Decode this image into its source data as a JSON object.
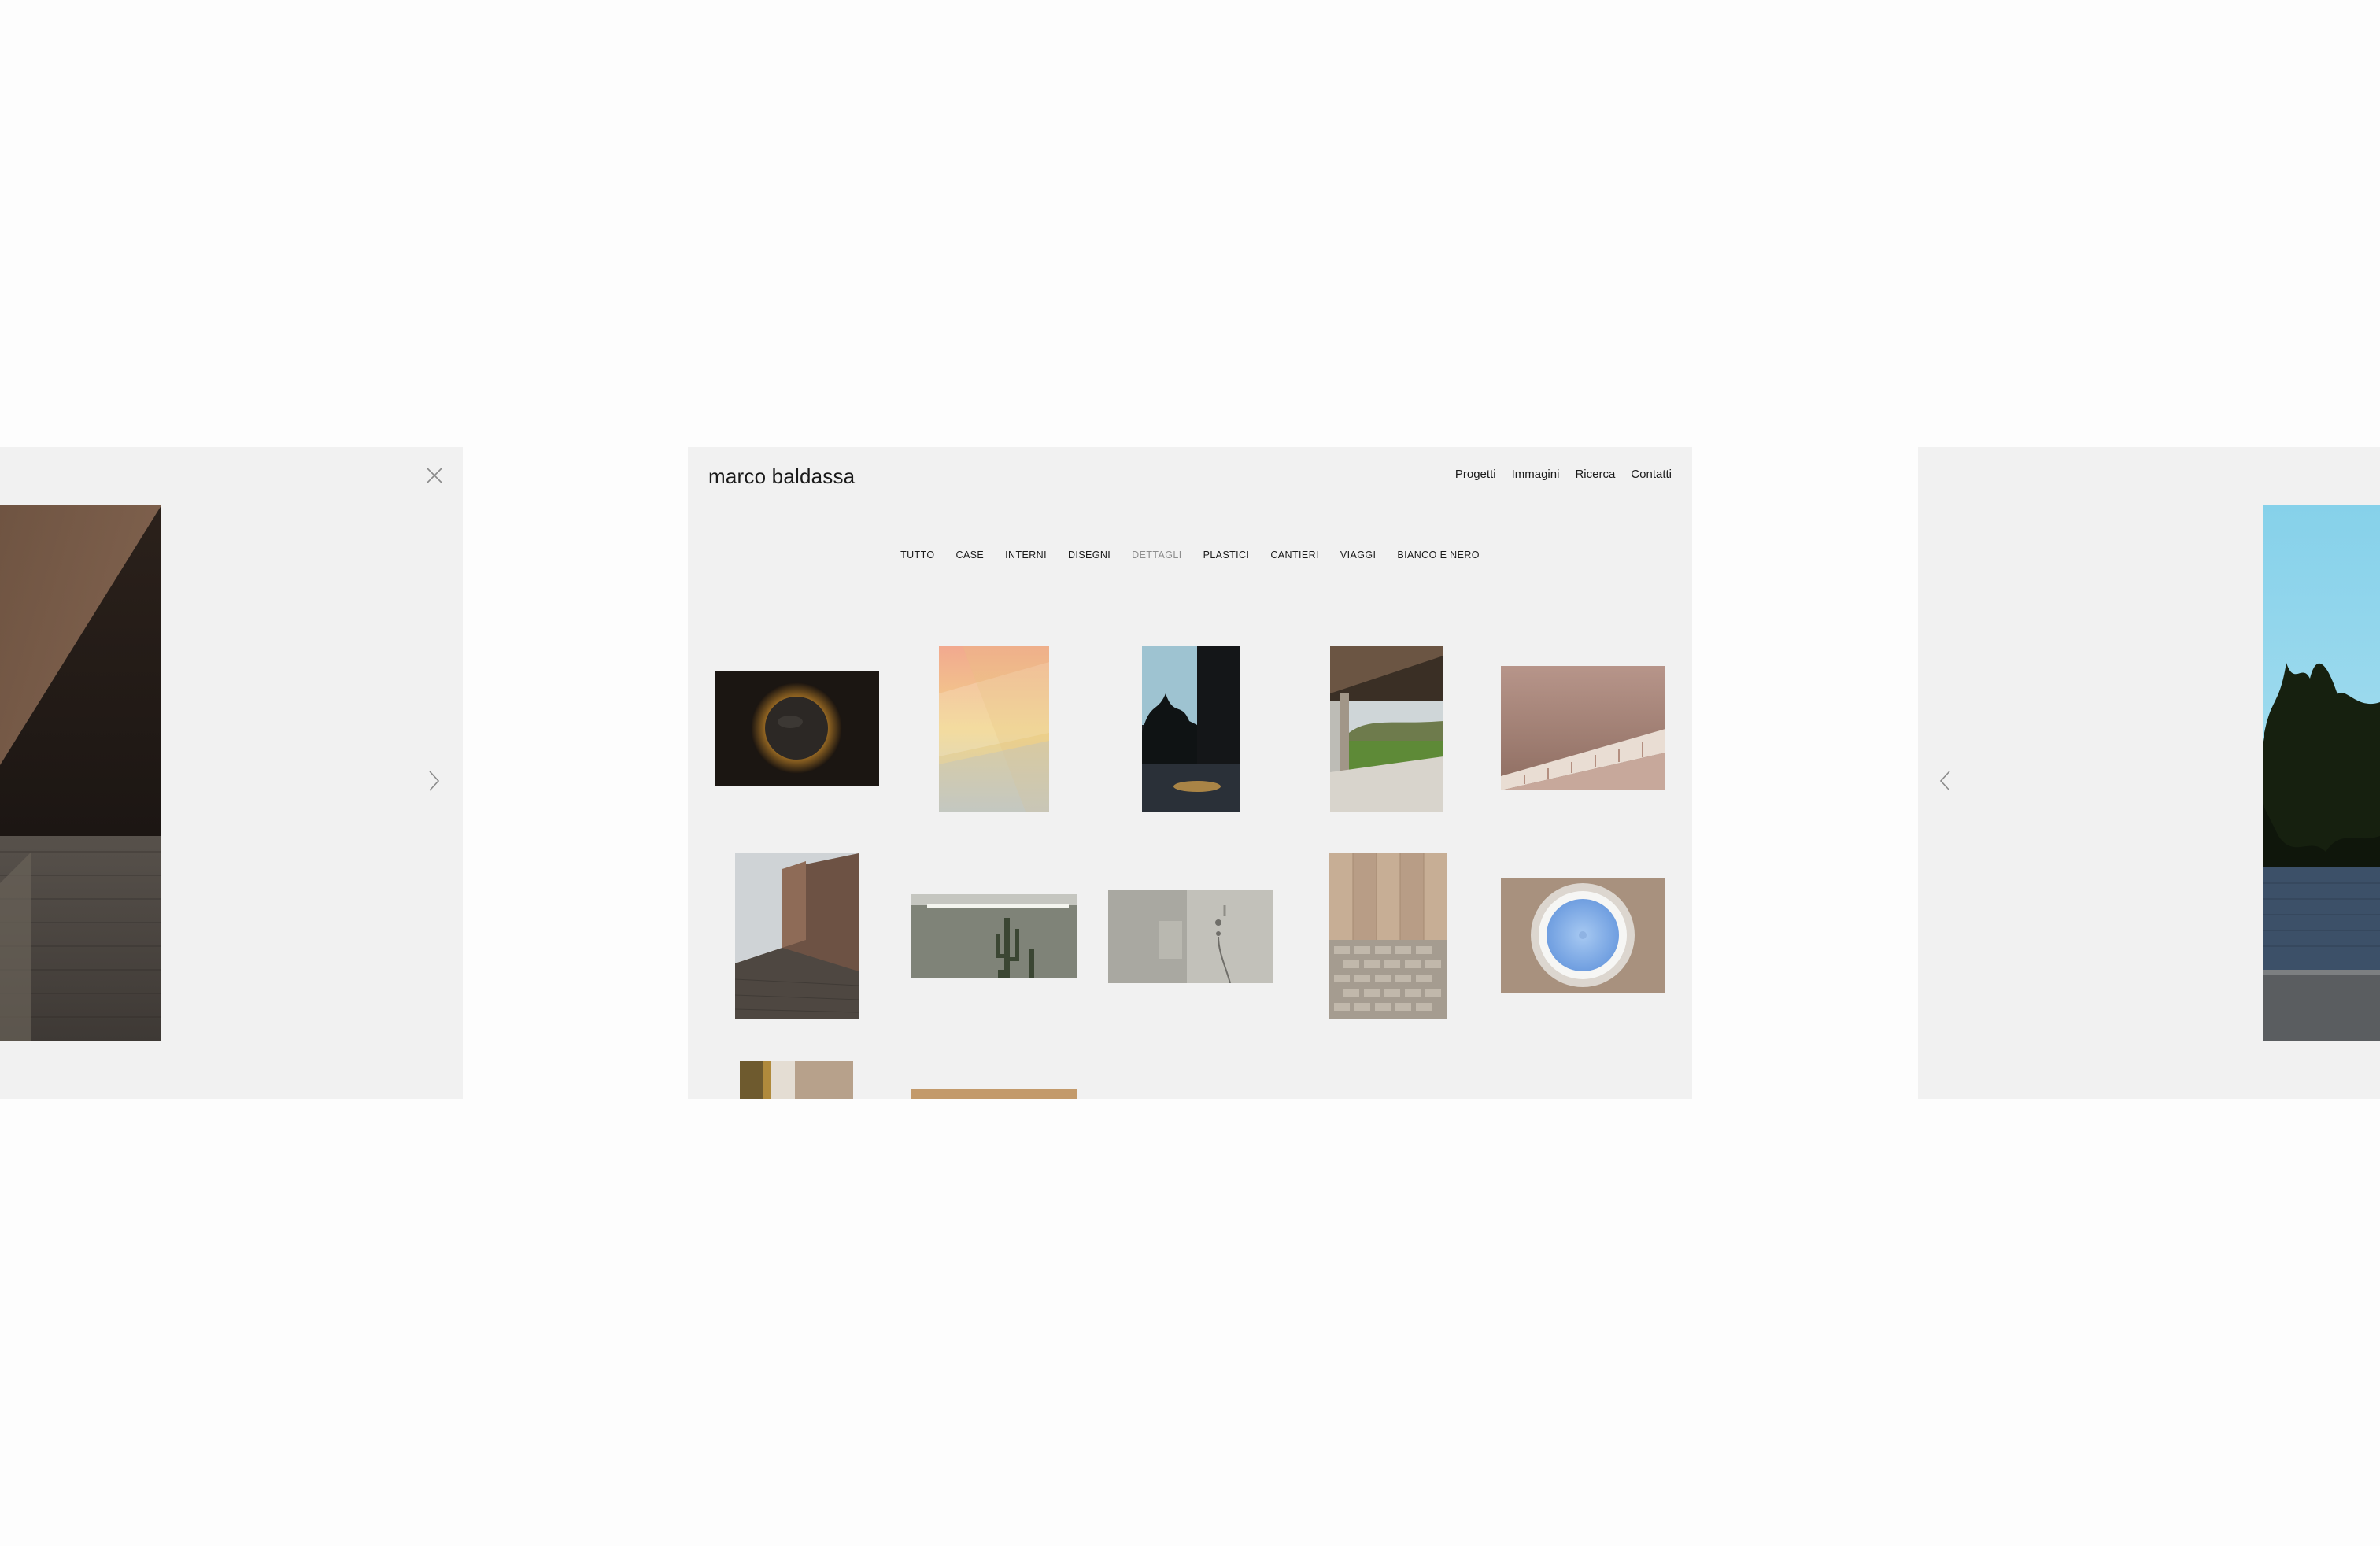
{
  "site": {
    "logo": "marco baldassa",
    "nav": [
      "Progetti",
      "Immagini",
      "Ricerca",
      "Contatti"
    ]
  },
  "filters": {
    "items": [
      "TUTTO",
      "CASE",
      "INTERNI",
      "DISEGNI",
      "DETTAGLI",
      "PLASTICI",
      "CANTIERI",
      "VIAGGI",
      "BIANCO E NERO"
    ],
    "active": "DETTAGLI"
  },
  "lightbox": {
    "close_icon": "close-icon",
    "next_icon": "chevron-right-icon",
    "prev_icon": "chevron-left-icon"
  },
  "gallery": {
    "thumbnails": [
      "eclipse-light",
      "pastel-gradient",
      "dark-trees-light",
      "portico-garden",
      "timber-ceiling",
      "concrete-facade",
      "cactus-niche",
      "shower-wall",
      "wood-paving",
      "round-skylight",
      "wood-column",
      "wood-strip"
    ]
  },
  "colors": {
    "panel": "#f1f1f1",
    "background": "#fdfdfd",
    "text": "#1a1a1a",
    "active_filter": "#8d8d8d"
  }
}
